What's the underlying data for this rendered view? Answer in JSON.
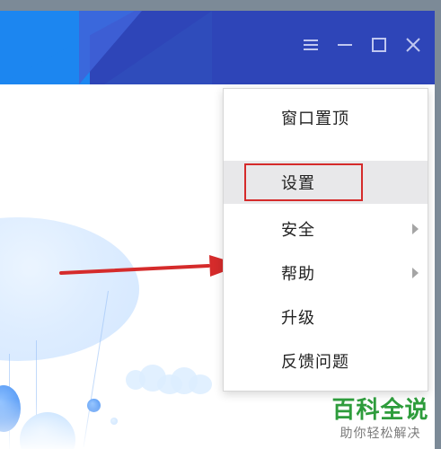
{
  "window": {
    "controls": {
      "menu_icon": "menu-icon",
      "minimize_icon": "minimize-icon",
      "maximize_icon": "maximize-icon",
      "close_icon": "close-icon"
    }
  },
  "context_menu": {
    "items": [
      {
        "label": "窗口置顶",
        "has_submenu": false
      },
      {
        "label": "设置",
        "has_submenu": false,
        "highlighted": true
      },
      {
        "label": "安全",
        "has_submenu": true
      },
      {
        "label": "帮助",
        "has_submenu": true
      },
      {
        "label": "升级",
        "has_submenu": false
      },
      {
        "label": "反馈问题",
        "has_submenu": false
      }
    ]
  },
  "annotation": {
    "arrow_color": "#d52b2b",
    "highlight_color": "#d52b2b"
  },
  "watermark": {
    "title": "百科全说",
    "subtitle": "助你轻松解决",
    "color": "#2e9c3c"
  },
  "colors": {
    "titlebar": "#2e45b8",
    "accent": "#1c86f0",
    "menu_hover": "#e8e8ea"
  }
}
